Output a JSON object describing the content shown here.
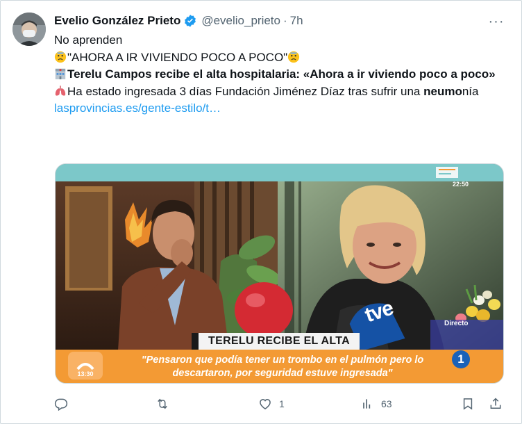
{
  "tweet": {
    "author_name": "Evelio González Prieto",
    "handle": "@evelio_prieto",
    "separator": "·",
    "time": "7h",
    "more_label": "···",
    "lines": {
      "l1": "No aprenden",
      "l2": "\"AHORA A IR VIVIENDO POCO A POCO\"",
      "l3_bold": "Terelu Campos recibe el alta hospitalaria: «Ahora a ir viviendo poco a poco»",
      "l4_a": "Ha estado ingresada 3 días Fundación Jiménez Díaz tras sufrir una ",
      "l4_bold": "neumo",
      "l4_b": "nía",
      "link": "lasprovincias.es/gente-estilo/t…"
    }
  },
  "media": {
    "chyron": "TERELU RECIBE EL ALTA",
    "quote": "\"Pensaron que podía tener un trombo en el pulmón pero lo descartaron, por seguridad estuve ingresada\"",
    "clock_left": "13:30",
    "clock_right": "22:50",
    "mic_logo": "tve",
    "live": "Directo",
    "channel": "1"
  },
  "actions": {
    "reply_count": "",
    "retweet_count": "",
    "like_count": "1",
    "views_count": "63"
  },
  "colors": {
    "link": "#1d9bf0",
    "muted": "#536471",
    "verified": "#1d9bf0",
    "lower_third": "#f39a34"
  },
  "icons": [
    "verified-badge-icon",
    "more-icon",
    "reply-icon",
    "retweet-icon",
    "like-icon",
    "views-icon",
    "bookmark-icon",
    "share-icon",
    "worried-face-emoji",
    "hospital-emoji",
    "lungs-emoji"
  ]
}
